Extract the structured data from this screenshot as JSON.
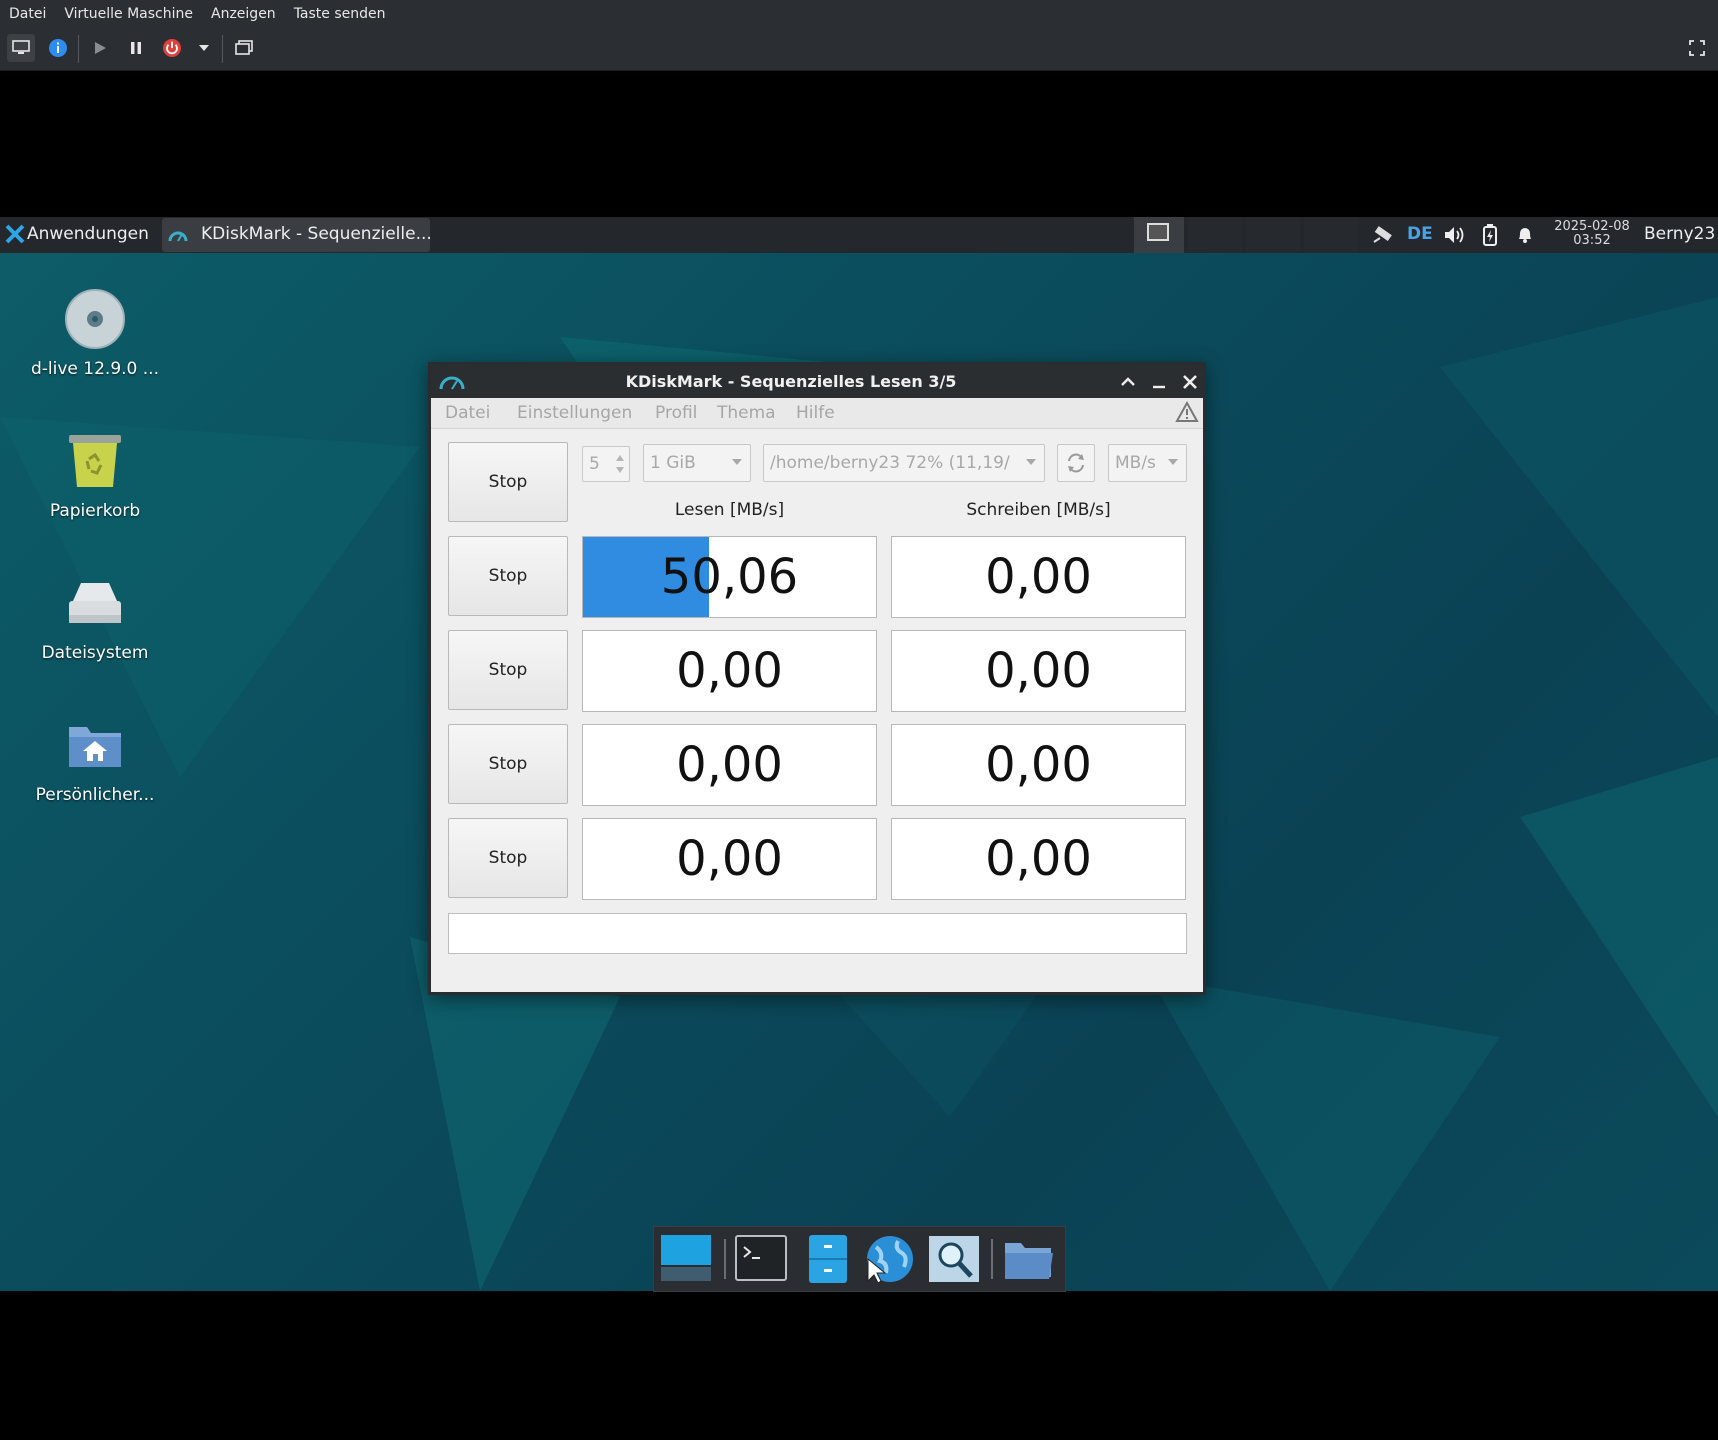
{
  "host": {
    "menu": [
      "Datei",
      "Virtuelle Maschine",
      "Anzeigen",
      "Taste senden"
    ]
  },
  "guest_panel": {
    "apps_label": "Anwendungen",
    "task_title": "KDiskMark - Sequenzielle...",
    "keyboard_layout": "DE",
    "date": "2025-02-08",
    "time": "03:52",
    "user": "Berny23"
  },
  "desktop_icons": [
    {
      "label": "d-live 12.9.0 ..."
    },
    {
      "label": "Papierkorb"
    },
    {
      "label": "Dateisystem"
    },
    {
      "label": "Persönlicher..."
    }
  ],
  "kdiskmark": {
    "title": "KDiskMark - Sequenzielles Lesen 3/5",
    "menu": [
      "Datei",
      "Einstellungen",
      "Profil",
      "Thema",
      "Hilfe"
    ],
    "runs": "5",
    "size": "1 GiB",
    "path": "/home/berny23 72% (11,19/",
    "unit": "MB/s",
    "read_header": "Lesen [MB/s]",
    "write_header": "Schreiben [MB/s]",
    "stop_all": "Stop",
    "rows": [
      {
        "stop": "Stop",
        "read": "50,06",
        "write": "0,00",
        "read_progress": 0.43
      },
      {
        "stop": "Stop",
        "read": "0,00",
        "write": "0,00"
      },
      {
        "stop": "Stop",
        "read": "0,00",
        "write": "0,00"
      },
      {
        "stop": "Stop",
        "read": "0,00",
        "write": "0,00"
      }
    ],
    "comment": ""
  },
  "colors": {
    "accent": "#2f8ce0",
    "panel": "#24272b"
  }
}
